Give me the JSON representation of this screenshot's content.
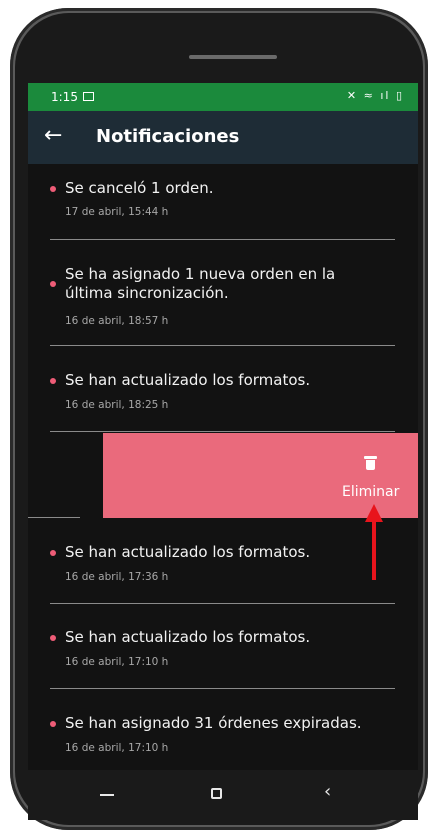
{
  "status_bar": {
    "time": "1:15",
    "icons": "✕ ≈ ıl ▯"
  },
  "header": {
    "title": "Notificaciones"
  },
  "notifications": [
    {
      "message": "Se canceló 1 orden.",
      "timestamp": "17 de abril, 15:44 h"
    },
    {
      "message": "Se ha asignado 1 nueva orden en la última sincronización.",
      "timestamp": "16 de abril, 18:57 h"
    },
    {
      "message": "Se han actualizado los formatos.",
      "timestamp": "16 de abril, 18:25 h"
    },
    {
      "message": "Se han actualizado los formatos.",
      "timestamp": "16 de abril, 17:36 h"
    },
    {
      "message": "Se han actualizado los formatos.",
      "timestamp": "16 de abril, 17:10 h"
    },
    {
      "message": "Se han asignado 31 órdenes expiradas.",
      "timestamp": "16 de abril, 17:10 h"
    }
  ],
  "swipe_action": {
    "label": "Eliminar",
    "icon": "trash-icon",
    "color": "#ea6a7c"
  },
  "colors": {
    "status_bar": "#1b8a3c",
    "app_bar": "#1e2c36",
    "bullet": "#ee5c77",
    "annotation_arrow": "#e8141c"
  }
}
